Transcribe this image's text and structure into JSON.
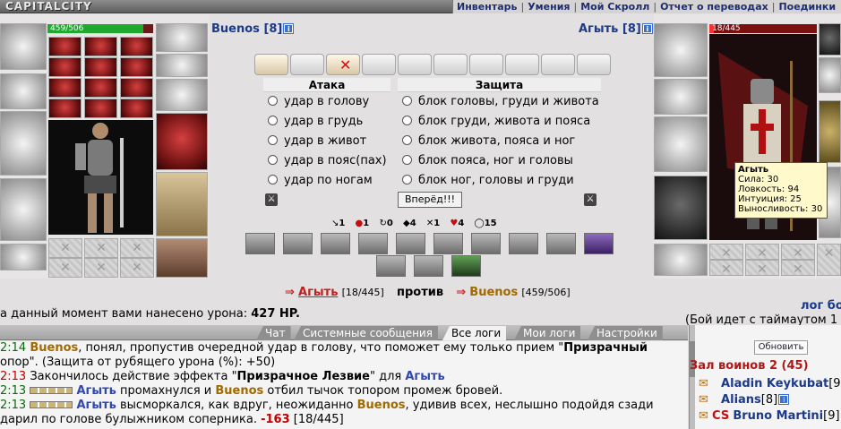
{
  "top": {
    "logo": "CAPITALCITY",
    "menu": [
      "Инвентарь",
      "Умения",
      "Мой Скролл",
      "Отчет о переводах",
      "Поединки"
    ]
  },
  "left_player": {
    "name": "Buenos",
    "level": "[8]",
    "hp": "459/506",
    "hp_fraction": 0.907
  },
  "right_player": {
    "name": "Агыть",
    "level": "[8]",
    "hp": "18/445",
    "hp_fraction": 0.04
  },
  "attack": {
    "title": "Атака",
    "options": [
      "удар в голову",
      "удар в грудь",
      "удар в живот",
      "удар в пояс(пах)",
      "удар по ногам"
    ]
  },
  "defense": {
    "title": "Защита",
    "options": [
      "блок головы, груди и живота",
      "блок груди, живота и пояса",
      "блок живота, пояса и ног",
      "блок пояса, ног и головы",
      "блок ног, головы и груди"
    ]
  },
  "go_button": "Вперёд!!!",
  "stats": [
    "1",
    "1",
    "0",
    "4",
    "1",
    "4",
    "15"
  ],
  "tooltip": {
    "name": "Агыть",
    "lines": [
      "Сила: 30",
      "Ловкость: 94",
      "Интуиция: 25",
      "Выносливость: 30"
    ]
  },
  "versus": {
    "enemy_name": "Агыть",
    "enemy_hp": "[18/445]",
    "word": "против",
    "self_name": "Buenos",
    "self_hp": "[459/506]"
  },
  "damage_line": {
    "text": "а данный момент вами нанесено урона:",
    "value": "427 HP."
  },
  "right_info": {
    "top": "лог бо",
    "timeout": "(Бой идет с таймаутом 1"
  },
  "tabs": [
    "Чат",
    "Системные сообщения",
    "Все логи",
    "Мои логи",
    "Настройки"
  ],
  "log": [
    {
      "time": "2:14",
      "a": "Buenos",
      "text1": ", понял, пропустив очередной удар в голову, что поможет ему только прием \"",
      "bold": "Призрачный",
      "text2": ""
    },
    {
      "text": "опор\". (Защита от рубящего урона (%): +50)"
    },
    {
      "time": "2:13",
      "text1": "Закончилось действие эффекта \"",
      "bold": "Призрачное Лезвие",
      "text2": "\" для ",
      "b": "Агыть"
    },
    {
      "time": "2:13",
      "a": "Агыть",
      "text1": " промахнулся и ",
      "b": "Buenos",
      "text2": " отбил тычок топором промеж бровей."
    },
    {
      "time": "2:13",
      "a": "Агыть",
      "text1": " высморкался, как вдруг, неожиданно ",
      "b": "Buenos",
      "text2": ", удивив всех, неслышно подойдя сзади"
    },
    {
      "text": "дарил по голове булыжником соперника. ",
      "dmg": "-163",
      "hp": " [18/445]"
    }
  ],
  "room": {
    "refresh": "Обновить",
    "title": "Зал воинов 2 (45)",
    "members": [
      {
        "name": "Aladin Keykubat",
        "level": "[9]"
      },
      {
        "name": "Alians",
        "level": "[8]"
      },
      {
        "clan": "CS",
        "name": "Bruno Martini",
        "level": "[9]"
      }
    ]
  }
}
